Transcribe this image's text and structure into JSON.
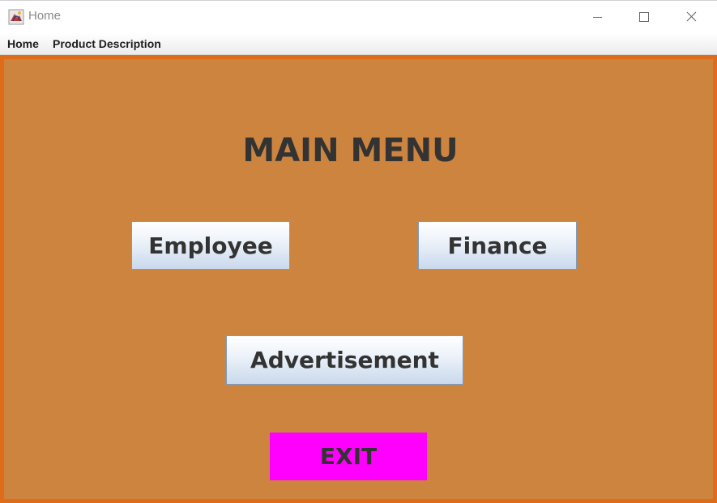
{
  "window": {
    "title": "Home"
  },
  "menubar": {
    "items": [
      {
        "label": "Home"
      },
      {
        "label": "Product Description"
      }
    ]
  },
  "main": {
    "title": "MAIN MENU",
    "buttons": {
      "employee": "Employee",
      "finance": "Finance",
      "advertisement": "Advertisement",
      "exit": "EXIT"
    }
  },
  "colors": {
    "panel_background": "#cd843f",
    "panel_border": "#de6c18",
    "exit_button": "#ff00ff",
    "text": "#333333"
  },
  "icons": {
    "app": "java-app-icon",
    "minimize": "minimize-icon",
    "maximize": "maximize-icon",
    "close": "close-icon"
  }
}
